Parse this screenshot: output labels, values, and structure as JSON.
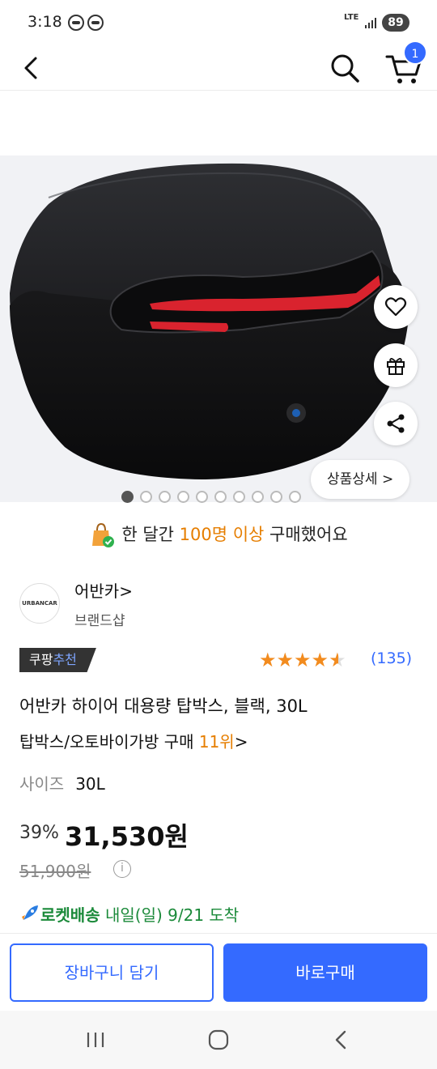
{
  "status_bar": {
    "time": "3:18",
    "network": "LTE",
    "battery": "89"
  },
  "header": {
    "cart_count": "1"
  },
  "gallery": {
    "detail_label": "상품상세 >",
    "total_images": 10,
    "active_index": 0
  },
  "purchase": {
    "prefix": "한 달간 ",
    "highlight": "100명 이상",
    "suffix": " 구매했어요"
  },
  "seller": {
    "logo_text": "URBANCAR",
    "name": "어반카>",
    "type": "브랜드샵"
  },
  "badge": {
    "brand": "쿠팡",
    "label": "추천"
  },
  "rating": {
    "stars": 4.5,
    "count": "(135)"
  },
  "product": {
    "title": "어반카 하이어 대용량 탑박스, 블랙, 30L",
    "ranking_prefix": "탑박스/오토바이가방 구매 ",
    "ranking_rank": "11위",
    "ranking_suffix": ">",
    "size_label": "사이즈",
    "size_value": "30L"
  },
  "price": {
    "discount": "39%",
    "sale": "31,530원",
    "original": "51,900원"
  },
  "delivery": {
    "method": "로켓배송",
    "date": " 내일(일) 9/21",
    "suffix": " 도착"
  },
  "actions": {
    "cart_label": "장바구니 담기",
    "buy_label": "바로구매"
  },
  "colors": {
    "accent": "#346aff",
    "highlight": "#e67e00",
    "rocket": "#1b8a3a"
  }
}
